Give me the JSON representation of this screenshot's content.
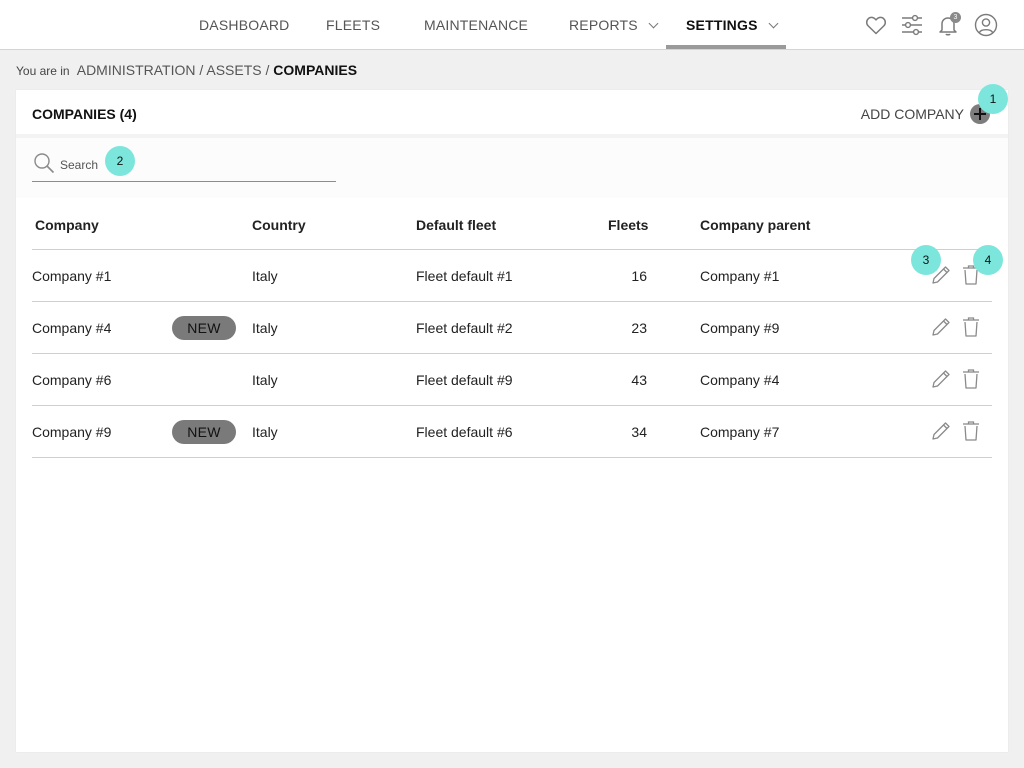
{
  "nav": {
    "items": [
      {
        "label": "DASHBOARD"
      },
      {
        "label": "FLEETS"
      },
      {
        "label": "MAINTENANCE"
      },
      {
        "label": "REPORTS"
      },
      {
        "label": "SETTINGS"
      }
    ],
    "notification_count": "3"
  },
  "breadcrumb": {
    "prefix": "You are in",
    "path": "ADMINISTRATION / ASSETS /",
    "current": "COMPANIES"
  },
  "card": {
    "title": "COMPANIES (4)",
    "add_label": "ADD COMPANY"
  },
  "search": {
    "placeholder": "Search"
  },
  "table": {
    "columns": [
      "Company",
      "Country",
      "Default fleet",
      "Fleets",
      "Company parent"
    ],
    "badge_label": "NEW",
    "rows": [
      {
        "company": "Company #1",
        "country": "Italy",
        "default_fleet": "Fleet default #1",
        "fleets": "16",
        "parent": "Company #1"
      },
      {
        "company": "Company #4",
        "country": "Italy",
        "default_fleet": "Fleet default #2",
        "fleets": "23",
        "parent": "Company #9"
      },
      {
        "company": "Company #6",
        "country": "Italy",
        "default_fleet": "Fleet default #9",
        "fleets": "43",
        "parent": "Company #4"
      },
      {
        "company": "Company #9",
        "country": "Italy",
        "default_fleet": "Fleet default #6",
        "fleets": "34",
        "parent": "Company #7"
      }
    ]
  },
  "annotations": [
    "1",
    "2",
    "3",
    "4"
  ],
  "colors": {
    "marker": "#7de6dc",
    "badge": "#7a7a7a",
    "active_underline": "#9a9a9a"
  },
  "icons": {
    "top": [
      "heart-icon",
      "sliders-icon",
      "bell-icon",
      "user-icon"
    ],
    "row_actions": [
      "pencil-icon",
      "trash-icon"
    ],
    "search": "search-icon",
    "add": "plus-icon"
  }
}
